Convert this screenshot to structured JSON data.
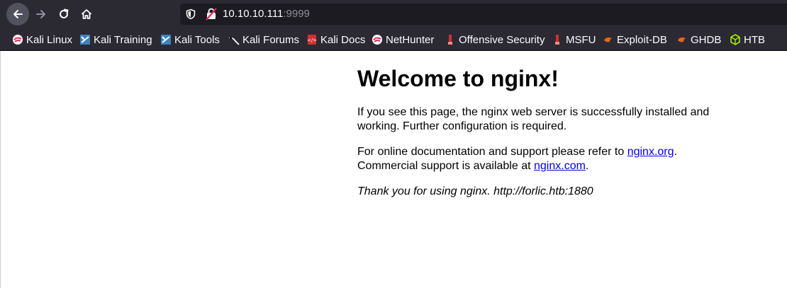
{
  "browser": {
    "url_host": "10.10.10.111",
    "url_port": ":9999",
    "bookmarks": [
      {
        "label": "Kali Linux",
        "icon": "kali-icon"
      },
      {
        "label": "Kali Training",
        "icon": "kali-training-icon"
      },
      {
        "label": "Kali Tools",
        "icon": "kali-tools-icon"
      },
      {
        "label": "Kali Forums",
        "icon": "kali-forums-icon"
      },
      {
        "label": "Kali Docs",
        "icon": "kali-docs-icon"
      },
      {
        "label": "NetHunter",
        "icon": "nethunter-icon"
      },
      {
        "label": "Offensive Security",
        "icon": "offsec-icon"
      },
      {
        "label": "MSFU",
        "icon": "msfu-icon"
      },
      {
        "label": "Exploit-DB",
        "icon": "exploit-db-icon"
      },
      {
        "label": "GHDB",
        "icon": "ghdb-icon"
      },
      {
        "label": "HTB",
        "icon": "htb-icon"
      }
    ],
    "colors": {
      "chrome_bg": "#2b2a33",
      "urlbar_bg": "#1c1b22",
      "text": "#fbfbfe"
    }
  },
  "page": {
    "title": "Welcome to nginx!",
    "p1": "If you see this page, the nginx web server is successfully installed and working. Further configuration is required.",
    "p2_prefix": "For online documentation and support please refer to ",
    "p2_link1": "nginx.org",
    "p2_mid": ".",
    "p2_line2_prefix": "Commercial support is available at ",
    "p2_link2": "nginx.com",
    "p2_suffix": ".",
    "p3": "Thank you for using nginx. http://forlic.htb:1880"
  }
}
